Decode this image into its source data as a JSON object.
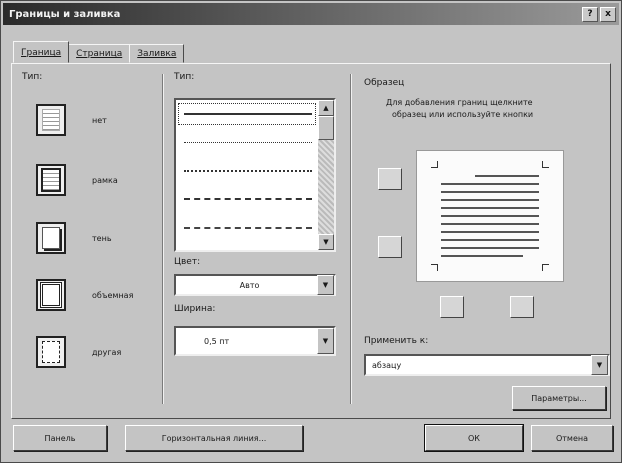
{
  "window": {
    "title": "Границы и заливка",
    "help": "?",
    "close": "x"
  },
  "tabs": [
    {
      "label": "Граница"
    },
    {
      "label": "Страница"
    },
    {
      "label": "Заливка"
    }
  ],
  "type_section": {
    "label": "Тип:",
    "items": [
      {
        "label": "нет",
        "icon": "border-none-icon"
      },
      {
        "label": "рамка",
        "icon": "border-frame-icon"
      },
      {
        "label": "тень",
        "icon": "border-shadow-icon"
      },
      {
        "label": "объемная",
        "icon": "border-3d-icon"
      },
      {
        "label": "другая",
        "icon": "border-custom-icon"
      }
    ]
  },
  "style_section": {
    "label": "Тип:",
    "color_label": "Цвет:",
    "color_value": "Авто",
    "width_label": "Ширина:",
    "width_value": "0,5 пт"
  },
  "sample_section": {
    "label": "Образец",
    "hint_line1": "Для добавления границ щелкните",
    "hint_line2": "образец или используйте кнопки",
    "apply_label": "Применить к:",
    "apply_value": "абзацу",
    "params_button": "Параметры..."
  },
  "footer": {
    "panel_button": "Панель",
    "hline_button": "Горизонтальная линия...",
    "ok_button": "ОК",
    "cancel_button": "Отмена"
  }
}
